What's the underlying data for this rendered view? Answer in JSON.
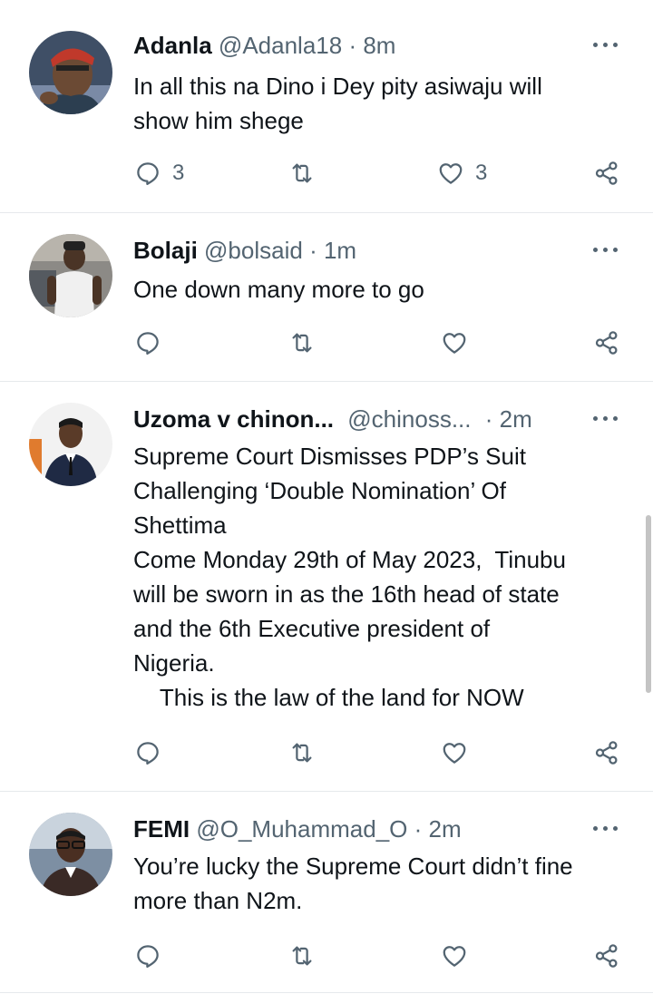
{
  "tweets": [
    {
      "name": "Adanla",
      "handle": "@Adanla18",
      "separator": "·",
      "time": "8m",
      "text": "In all this na Dino i Dey pity asiwaju will\nshow him shege",
      "replies": "3",
      "likes": "3"
    },
    {
      "name": "Bolaji",
      "handle": "@bolsaid",
      "separator": "·",
      "time": "1m",
      "text": "One down many more to go",
      "replies": "",
      "likes": ""
    },
    {
      "name": "Uzoma v chinon...",
      "handle": "@chinoss...",
      "separator": "·",
      "time": "2m",
      "text": "Supreme Court Dismisses PDP’s Suit\nChallenging ‘Double Nomination’ Of\nShettima\nCome Monday 29th of May 2023,  Tinubu\nwill be sworn in as the 16th head of state\nand the 6th Executive president of\nNigeria.\n    This is the law of the land for NOW",
      "replies": "",
      "likes": ""
    },
    {
      "name": "FEMI",
      "handle": "@O_Muhammad_O",
      "separator": "·",
      "time": "2m",
      "text": "You’re lucky the Supreme Court didn’t fine\nmore than N2m.",
      "replies": "",
      "likes": ""
    }
  ],
  "icons": {
    "reply": "reply-icon",
    "retweet": "retweet-icon",
    "like": "heart-icon",
    "share": "share-icon",
    "more": "more-dots-icon"
  },
  "colors": {
    "text": "#0f1419",
    "secondary": "#536471",
    "divider": "#e6e9ec"
  }
}
